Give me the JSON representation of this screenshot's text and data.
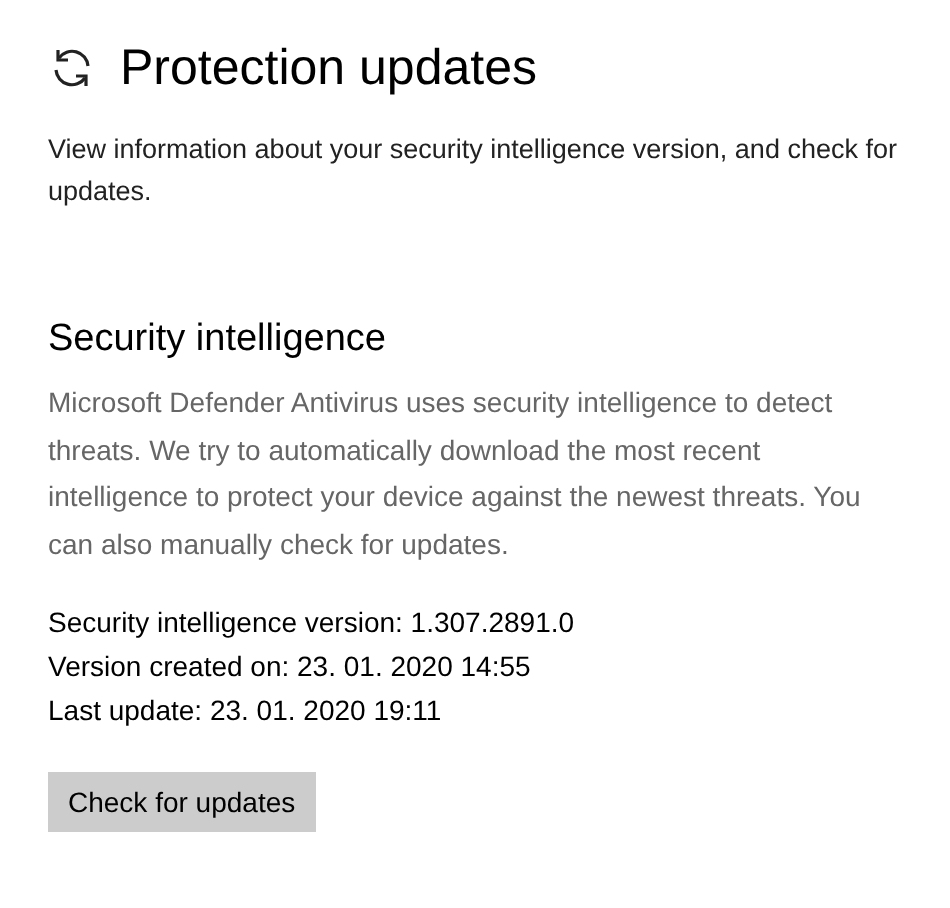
{
  "page": {
    "title": "Protection updates",
    "description": "View information about your security intelligence version, and check for updates."
  },
  "section": {
    "title": "Security intelligence",
    "description": "Microsoft Defender Antivirus uses security intelligence to detect threats. We try to automatically download the most recent intelligence to protect your device against the newest threats. You can also manually check for updates."
  },
  "info": [
    "Security intelligence version: 1.307.2891.0",
    "Version created on: 23. 01. 2020 14:55",
    "Last update: 23. 01. 2020 19:11"
  ],
  "button": {
    "label": "Check for updates"
  }
}
